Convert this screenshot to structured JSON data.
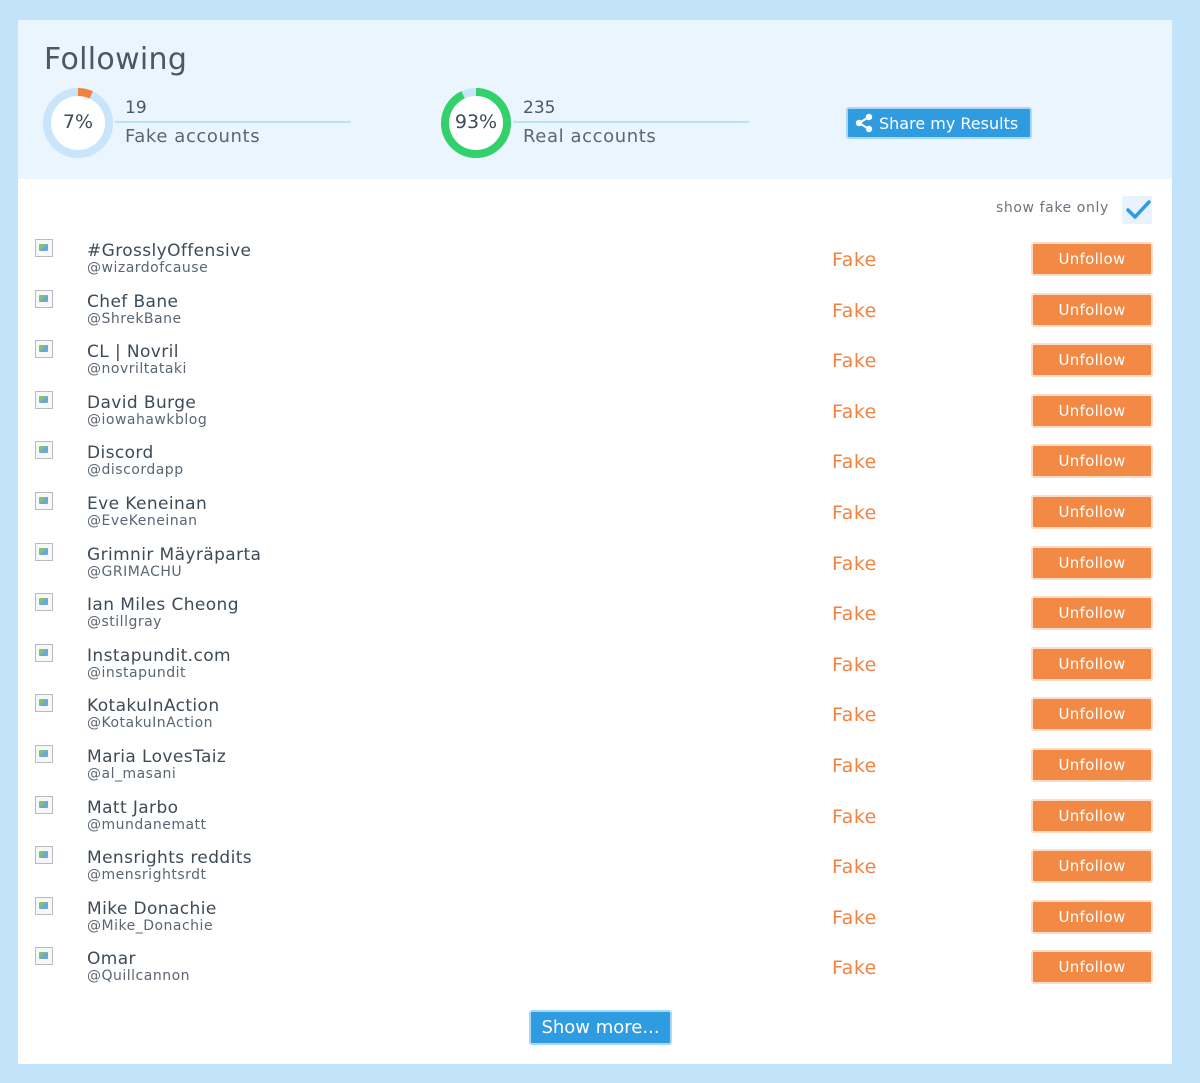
{
  "header": {
    "title": "Following",
    "fake": {
      "percent_label": "7%",
      "percent": 0.07,
      "count": "19",
      "label": "Fake accounts",
      "ring_color": "#f3823f"
    },
    "real": {
      "percent_label": "93%",
      "percent": 0.93,
      "count": "235",
      "label": "Real accounts",
      "ring_color": "#33d16a"
    },
    "share_button": {
      "label": "Share my Results",
      "icon": "share-icon"
    }
  },
  "filter": {
    "label": "show fake only",
    "checked": true,
    "icon": "checkmark-icon"
  },
  "accounts": [
    {
      "name": "#GrosslyOffensive",
      "handle": "@wizardofcause",
      "status": "Fake",
      "action": "Unfollow"
    },
    {
      "name": "Chef Bane",
      "handle": "@ShrekBane",
      "status": "Fake",
      "action": "Unfollow"
    },
    {
      "name": "CL | Novril",
      "handle": "@novriltataki",
      "status": "Fake",
      "action": "Unfollow"
    },
    {
      "name": "David Burge",
      "handle": "@iowahawkblog",
      "status": "Fake",
      "action": "Unfollow"
    },
    {
      "name": "Discord",
      "handle": "@discordapp",
      "status": "Fake",
      "action": "Unfollow"
    },
    {
      "name": "Eve Keneinan",
      "handle": "@EveKeneinan",
      "status": "Fake",
      "action": "Unfollow"
    },
    {
      "name": "Grimnir Mäyräparta",
      "handle": "@GRIMACHU",
      "status": "Fake",
      "action": "Unfollow"
    },
    {
      "name": "Ian Miles Cheong",
      "handle": "@stillgray",
      "status": "Fake",
      "action": "Unfollow"
    },
    {
      "name": "Instapundit.com",
      "handle": "@instapundit",
      "status": "Fake",
      "action": "Unfollow"
    },
    {
      "name": "KotakuInAction",
      "handle": "@KotakuInAction",
      "status": "Fake",
      "action": "Unfollow"
    },
    {
      "name": "Maria LovesTaiz",
      "handle": "@al_masani",
      "status": "Fake",
      "action": "Unfollow"
    },
    {
      "name": "Matt Jarbo",
      "handle": "@mundanematt",
      "status": "Fake",
      "action": "Unfollow"
    },
    {
      "name": "Mensrights reddits",
      "handle": "@mensrightsrdt",
      "status": "Fake",
      "action": "Unfollow"
    },
    {
      "name": "Mike Donachie",
      "handle": "@Mike_Donachie",
      "status": "Fake",
      "action": "Unfollow"
    },
    {
      "name": "Omar",
      "handle": "@Quillcannon",
      "status": "Fake",
      "action": "Unfollow"
    }
  ],
  "show_more": {
    "label": "Show more..."
  }
}
